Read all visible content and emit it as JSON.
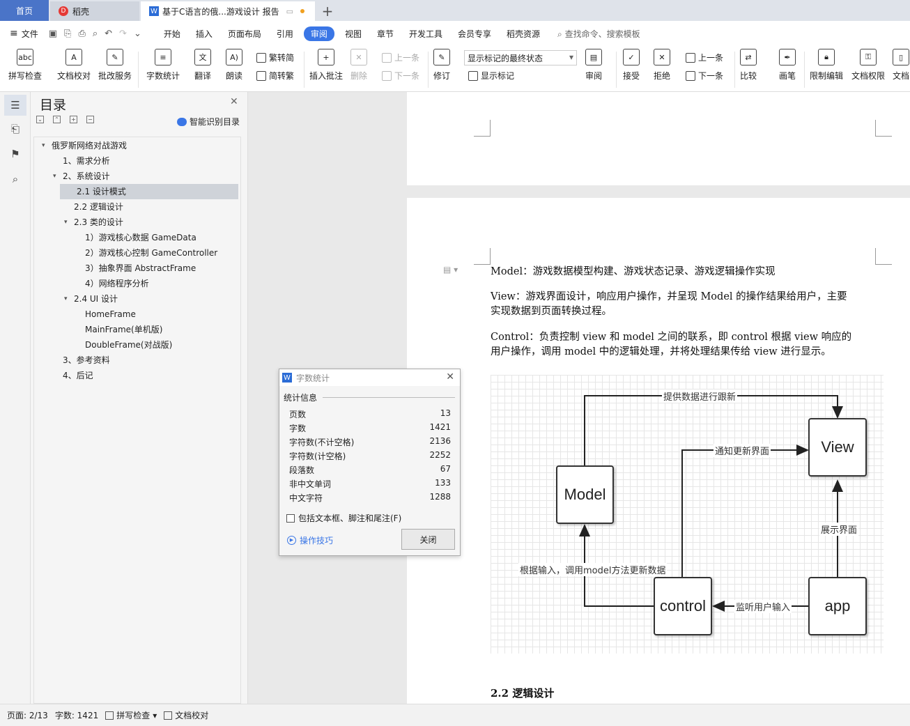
{
  "tabs": {
    "home": "首页",
    "doke": "稻壳",
    "doc": "基于C语言的俄...游戏设计 报告"
  },
  "menu": {
    "file": "文件",
    "items": [
      "开始",
      "插入",
      "页面布局",
      "引用",
      "审阅",
      "视图",
      "章节",
      "开发工具",
      "会员专享",
      "稻壳资源"
    ],
    "active_index": 4,
    "search": "查找命令、搜索模板"
  },
  "ribbon": {
    "spell": "拼写检查",
    "proof": "文档校对",
    "annotate_service": "批改服务",
    "word_count": "字数统计",
    "translate": "翻译",
    "read_aloud": "朗读",
    "trad": "繁转简",
    "simp": "简转繁",
    "insert_comment": "插入批注",
    "delete": "删除",
    "prev": "上一条",
    "next": "下一条",
    "revise": "修订",
    "display_state": "显示标记的最终状态",
    "show_marks": "显示标记",
    "review": "审阅",
    "accept": "接受",
    "reject": "拒绝",
    "prev2": "上一条",
    "next2": "下一条",
    "compare": "比较",
    "pen": "画笔",
    "restrict": "限制编辑",
    "perm": "文档权限",
    "more": "文档"
  },
  "toc": {
    "title": "目录",
    "smart": "智能识别目录",
    "items": [
      {
        "label": "俄罗斯网络对战游戏",
        "level": 0,
        "caret": "▾"
      },
      {
        "label": "1、需求分析",
        "level": 1,
        "caret": ""
      },
      {
        "label": "2、系统设计",
        "level": 1,
        "caret": "▾"
      },
      {
        "label": "2.1  设计模式",
        "level": 2,
        "caret": "",
        "selected": true
      },
      {
        "label": "2.2  逻辑设计",
        "level": 2,
        "caret": ""
      },
      {
        "label": "2.3  类的设计",
        "level": 2,
        "caret": "▾"
      },
      {
        "label": "1）游戏核心数据 GameData",
        "level": 3,
        "caret": ""
      },
      {
        "label": "2）游戏核心控制 GameController",
        "level": 3,
        "caret": ""
      },
      {
        "label": "3）抽象界面 AbstractFrame",
        "level": 3,
        "caret": ""
      },
      {
        "label": "4）网络程序分析",
        "level": 3,
        "caret": ""
      },
      {
        "label": "2.4 UI  设计",
        "level": 2,
        "caret": "▾"
      },
      {
        "label": "HomeFrame",
        "level": 3,
        "caret": ""
      },
      {
        "label": "MainFrame(单机版)",
        "level": 3,
        "caret": ""
      },
      {
        "label": "DoubleFrame(对战版)",
        "level": 3,
        "caret": ""
      },
      {
        "label": "3、参考资料",
        "level": 1,
        "caret": ""
      },
      {
        "label": "4、后记",
        "level": 1,
        "caret": ""
      }
    ]
  },
  "doc": {
    "p1": "Model：游戏数据模型构建、游戏状态记录、游戏逻辑操作实现",
    "p2a": "View：游戏界面设计，响应用户操作，并呈现 Model 的操作结果给用户，主要",
    "p2b": "实现数据到页面转换过程。",
    "p3a": "Control：负责控制 view 和 model 之间的联系，即 control 根据 view 响应的",
    "p3b": "用户操作，调用 model 中的逻辑处理，并将处理结果传给 view 进行显示。",
    "heading": "2.2  逻辑设计"
  },
  "diagram": {
    "model": "Model",
    "view": "View",
    "control": "control",
    "app": "app",
    "l1": "提供数据进行跟新",
    "l2": "通知更新界面",
    "l3": "展示界面",
    "l4": "根据输入，调用model方法更新数据",
    "l5": "监听用户输入"
  },
  "dialog": {
    "title": "字数统计",
    "group": "统计信息",
    "rows": [
      {
        "k": "页数",
        "v": "13"
      },
      {
        "k": "字数",
        "v": "1421"
      },
      {
        "k": "字符数(不计空格)",
        "v": "2136"
      },
      {
        "k": "字符数(计空格)",
        "v": "2252"
      },
      {
        "k": "段落数",
        "v": "67"
      },
      {
        "k": "非中文单词",
        "v": "133"
      },
      {
        "k": "中文字符",
        "v": "1288"
      }
    ],
    "check": "包括文本框、脚注和尾注(F)",
    "tips": "操作技巧",
    "close": "关闭"
  },
  "status": {
    "page": "页面: 2/13",
    "words": "字数: 1421",
    "spell": "拼写检查",
    "proof": "文档校对"
  }
}
